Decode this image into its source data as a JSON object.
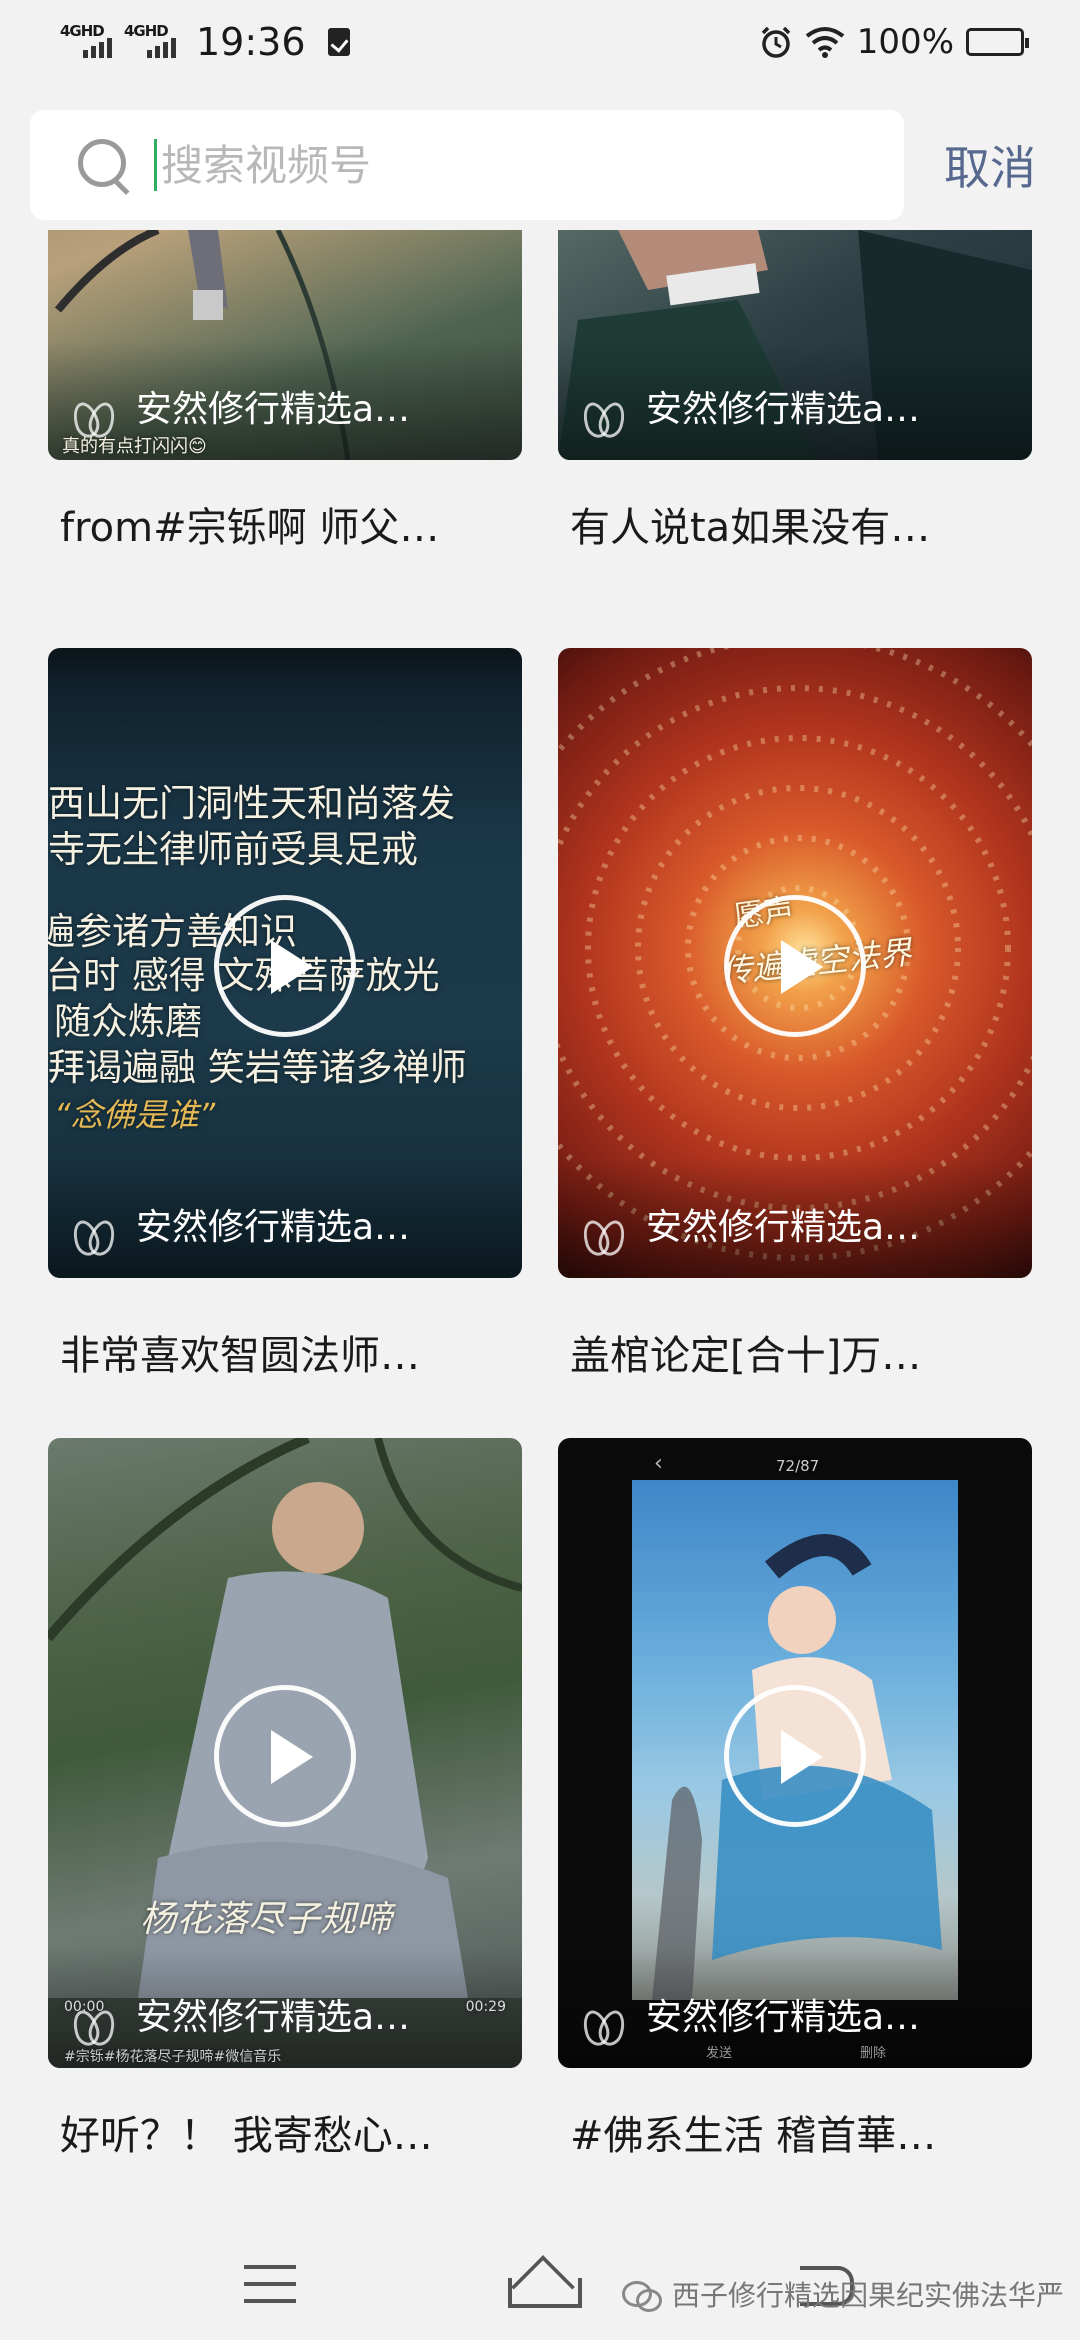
{
  "status_bar": {
    "network_1": "4GHD",
    "network_2": "4GHD",
    "time": "19:36",
    "battery": "100%"
  },
  "search": {
    "placeholder": "搜索视频号",
    "value": "",
    "cancel_label": "取消"
  },
  "videos": [
    {
      "channel": "安然修行精选a…",
      "caption": "from#宗铄啊 师父…",
      "overlay_lines": [
        "真的有点打闪闪😊"
      ]
    },
    {
      "channel": "安然修行精选a…",
      "caption": "有人说ta如果没有…",
      "overlay_lines": []
    },
    {
      "channel": "安然修行精选a…",
      "caption": "非常喜欢智圆法师…",
      "overlay_lines": [
        "西山无门洞性天和尚落发",
        "寺无尘律师前受具足戒",
        "遍参诸方善知识",
        "台时 感得 文殊菩萨放光",
        "随众炼磨",
        "拜谒遍融 笑岩等诸多禅师",
        "“念佛是谁”"
      ]
    },
    {
      "channel": "安然修行精选a…",
      "caption": "盖棺论定[合十]万…",
      "overlay_lines": [
        "愿声",
        "传遍虚空法界"
      ]
    },
    {
      "channel": "安然修行精选a…",
      "caption": "好听？！ 我寄愁心…",
      "overlay_lines": [
        "杨花落尽子规啼",
        "00:00",
        "00:29",
        "#宗铄#杨花落尽子规啼#微信音乐"
      ]
    },
    {
      "channel": "安然修行精选a…",
      "caption": "#佛系生活 稽首華…",
      "overlay_lines": [
        "72/87",
        "发送",
        "删除"
      ]
    }
  ],
  "watermark": "西子修行精选因果纪实佛法华严",
  "colors": {
    "background": "#f2f2f2",
    "cancel": "#57688e",
    "caret": "#2fae62"
  }
}
